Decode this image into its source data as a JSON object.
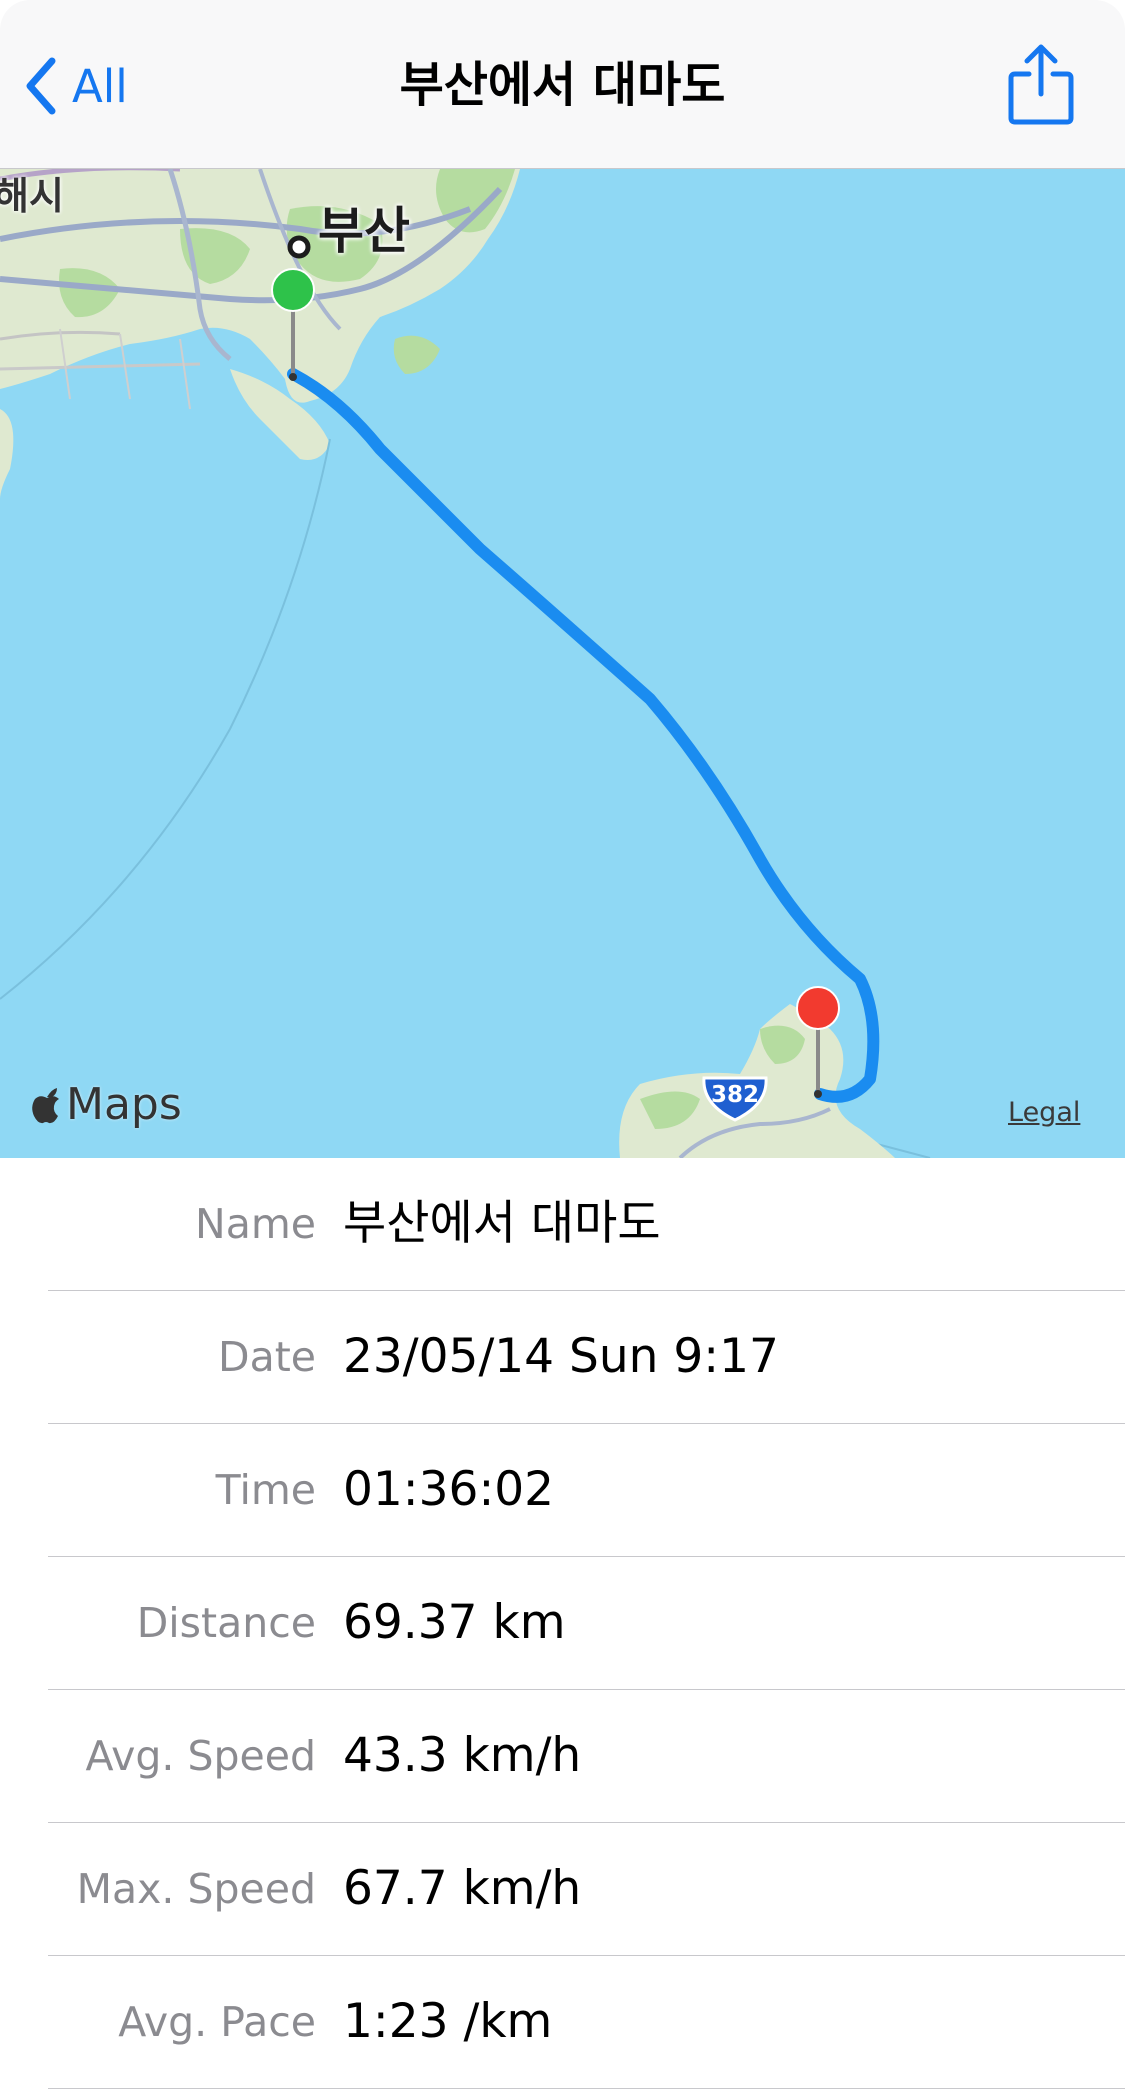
{
  "nav": {
    "back_label": "All",
    "title": "부산에서 대마도"
  },
  "map": {
    "city_label": "부산",
    "partial_city_label": "해시",
    "attribution": "Maps",
    "legal_label": "Legal",
    "route_shield": "382",
    "route_color": "#1a8cf0",
    "start_pin_color": "#2ec24a",
    "end_pin_color": "#f23a2f",
    "water_color": "#8fd8f4",
    "land_color": "#dfe9d0"
  },
  "details": [
    {
      "label": "Name",
      "value": "부산에서 대마도"
    },
    {
      "label": "Date",
      "value": "23/05/14 Sun 9:17"
    },
    {
      "label": "Time",
      "value": "01:36:02"
    },
    {
      "label": "Distance",
      "value": "69.37 km"
    },
    {
      "label": "Avg. Speed",
      "value": "43.3 km/h"
    },
    {
      "label": "Max. Speed",
      "value": "67.7 km/h"
    },
    {
      "label": "Avg. Pace",
      "value": "1:23 /km"
    }
  ]
}
